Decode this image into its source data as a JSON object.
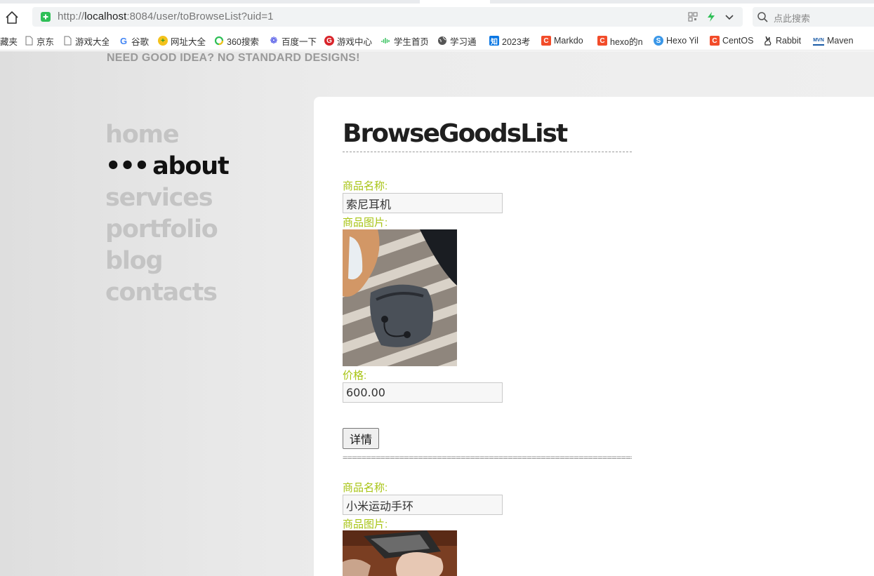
{
  "browser": {
    "url_scheme": "http://",
    "url_host": "localhost",
    "url_rest": ":8084/user/toBrowseList?uid=1",
    "search_placeholder": "点此搜索",
    "bookmarks": [
      {
        "label": "藏夹",
        "icon": "none"
      },
      {
        "label": "京东",
        "icon": "page-icon"
      },
      {
        "label": "游戏大全",
        "icon": "page-icon"
      },
      {
        "label": "谷歌",
        "icon": "google-icon"
      },
      {
        "label": "网址大全",
        "icon": "plus-circle-icon"
      },
      {
        "label": "360搜索",
        "icon": "360-icon"
      },
      {
        "label": "百度一下",
        "icon": "baidu-paw-icon"
      },
      {
        "label": "游戏中心",
        "icon": "game-icon"
      },
      {
        "label": "学生首页",
        "icon": "wave-icon"
      },
      {
        "label": "学习通",
        "icon": "globe-icon"
      },
      {
        "label": "2023考",
        "icon": "zhihu-icon"
      },
      {
        "label": "Markdo",
        "icon": "csdn-icon"
      },
      {
        "label": "hexo的n",
        "icon": "csdn-icon"
      },
      {
        "label": "Hexo Yil",
        "icon": "s-icon"
      },
      {
        "label": "CentOS",
        "icon": "csdn-icon"
      },
      {
        "label": "Rabbit",
        "icon": "rabbit-icon"
      },
      {
        "label": "Maven",
        "icon": "mvn-icon"
      }
    ]
  },
  "site": {
    "tagline": "NEED GOOD IDEA? NO STANDARD DESIGNS!",
    "nav": [
      {
        "label": "home",
        "active": false
      },
      {
        "label": "about",
        "active": true
      },
      {
        "label": "services",
        "active": false
      },
      {
        "label": "portfolio",
        "active": false
      },
      {
        "label": "blog",
        "active": false
      },
      {
        "label": "contacts",
        "active": false
      }
    ],
    "active_marker": "•••"
  },
  "content": {
    "title": "BrowseGoodsList",
    "separator": "==============================================================",
    "goods": [
      {
        "name_label": "商品名称:",
        "name": "索尼耳机",
        "image_label": "商品图片:",
        "price_label": "价格:",
        "price": "600.00",
        "detail_label": "详情"
      },
      {
        "name_label": "商品名称:",
        "name": "小米运动手环",
        "image_label": "商品图片:"
      }
    ]
  }
}
